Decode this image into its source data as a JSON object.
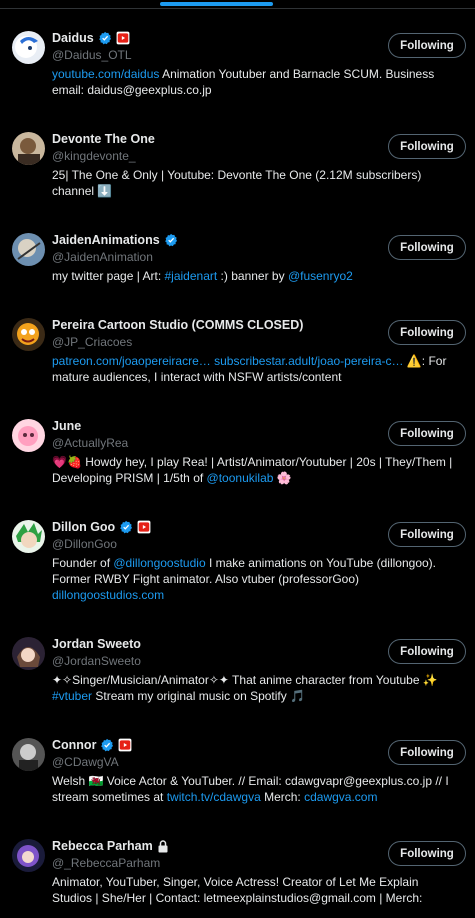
{
  "follow_label": "Following",
  "accent_color": "#1d9bf0",
  "users": [
    {
      "name": "Daidus",
      "handle": "@Daidus_OTL",
      "verified": true,
      "youtube_badge": true,
      "bio": [
        {
          "t": "youtube.com/daidus",
          "link": true
        },
        {
          "t": " Animation Youtuber and Barnacle SCUM. Business email: daidus@geexplus.co.jp"
        }
      ]
    },
    {
      "name": "Devonte The One",
      "handle": "@kingdevonte_",
      "bio": [
        {
          "t": "25| The One & Only | Youtube: Devonte The One (2.12M subscribers) channel "
        },
        {
          "t": "⬇️"
        }
      ]
    },
    {
      "name": "JaidenAnimations",
      "handle": "@JaidenAnimation",
      "verified": true,
      "bio": [
        {
          "t": "my twitter page | Art: "
        },
        {
          "t": "#jaidenart",
          "link": true
        },
        {
          "t": " :) banner by "
        },
        {
          "t": "@fusenryo2",
          "link": true
        }
      ]
    },
    {
      "name": "Pereira Cartoon Studio (COMMS CLOSED)",
      "handle": "@JP_Criacoes",
      "bio": [
        {
          "t": "patreon.com/joaopereiracre…",
          "link": true
        },
        {
          "t": " "
        },
        {
          "t": "subscribestar.adult/joao-pereira-c…",
          "link": true
        },
        {
          "t": " ⚠️: For mature audiences, I interact with NSFW artists/content"
        }
      ]
    },
    {
      "name": "June",
      "handle": "@ActuallyRea",
      "bio": [
        {
          "t": "💗🍓 Howdy hey, I play Rea! | Artist/Animator/Youtuber | 20s | They/Them | Developing PRISM | 1/5th of "
        },
        {
          "t": "@toonukilab",
          "link": true
        },
        {
          "t": " 🌸"
        }
      ]
    },
    {
      "name": "Dillon Goo",
      "handle": "@DillonGoo",
      "verified": true,
      "youtube_badge": true,
      "bio": [
        {
          "t": "Founder of "
        },
        {
          "t": "@dillongoostudio",
          "link": true
        },
        {
          "t": " I make animations on YouTube (dillongoo). Former RWBY Fight animator. Also vtuber (professorGoo) "
        },
        {
          "t": "dillongoostudios.com",
          "link": true
        }
      ]
    },
    {
      "name": "Jordan Sweeto",
      "handle": "@JordanSweeto",
      "bio": [
        {
          "t": "✦✧Singer/Musician/Animator✧✦ That anime character from Youtube ✨ "
        },
        {
          "t": "#vtuber",
          "link": true
        },
        {
          "t": " Stream my original music on Spotify 🎵"
        }
      ]
    },
    {
      "name": "Connor",
      "handle": "@CDawgVA",
      "verified": true,
      "youtube_badge": true,
      "bio": [
        {
          "t": "Welsh 🏴󠁧󠁢󠁷󠁬󠁳󠁿 Voice Actor & YouTuber. // Email: cdawgvapr@geexplus.co.jp // I stream sometimes at "
        },
        {
          "t": "twitch.tv/cdawgva",
          "link": true
        },
        {
          "t": " Merch: "
        },
        {
          "t": "cdawgva.com",
          "link": true
        }
      ]
    },
    {
      "name": "Rebecca Parham",
      "handle": "@_RebeccaParham",
      "locked": true,
      "bio": [
        {
          "t": "Animator, YouTuber, Singer, Voice Actress! Creator of Let Me Explain Studios | She/Her | Contact: letmeexplainstudios@gmail.com | Merch:"
        }
      ]
    }
  ]
}
